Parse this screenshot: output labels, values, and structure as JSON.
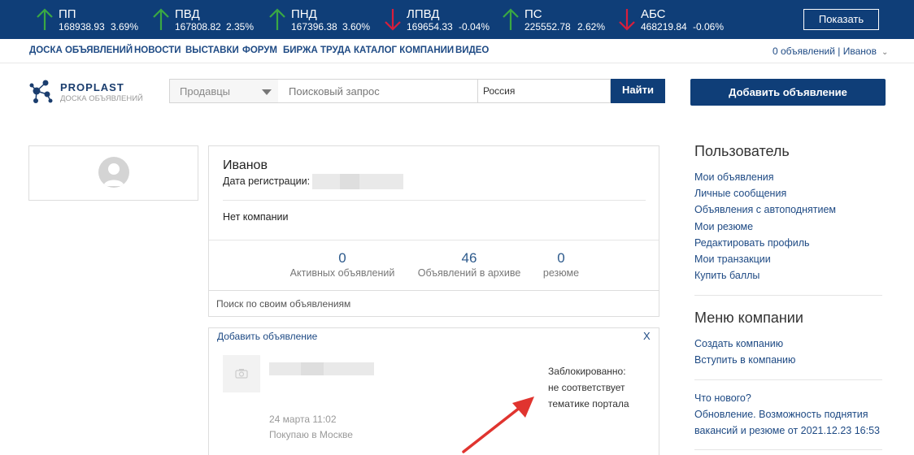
{
  "ticker": {
    "items": [
      {
        "name": "ПП",
        "price": "168938.93",
        "change": "3.69%",
        "direction": "up",
        "icon": "arrow-up-icon"
      },
      {
        "name": "ПВД",
        "price": "167808.82",
        "change": "2.35%",
        "direction": "up",
        "icon": "arrow-up-icon"
      },
      {
        "name": "ПНД",
        "price": "167396.38",
        "change": "3.60%",
        "direction": "up",
        "icon": "arrow-up-icon"
      },
      {
        "name": "ЛПВД",
        "price": "169654.33",
        "change": "-0.04%",
        "direction": "down",
        "icon": "arrow-down-icon"
      },
      {
        "name": "ПС",
        "price": "225552.78",
        "change": "2.62%",
        "direction": "up",
        "icon": "arrow-up-icon"
      },
      {
        "name": "АБС",
        "price": "468219.84",
        "change": "-0.06%",
        "direction": "down",
        "icon": "arrow-down-icon"
      }
    ],
    "show_button": "Показать",
    "colors": {
      "background": "#0f3e78",
      "up": "#3aa843",
      "down": "#d81e3c"
    }
  },
  "nav": {
    "links": [
      "ДОСКА ОБЪЯВЛЕНИЙ",
      "НОВОСТИ",
      "ВЫСТАВКИ",
      "ФОРУМ",
      "БИРЖА ТРУДА",
      "КАТАЛОГ КОМПАНИИ",
      "ВИДЕО"
    ],
    "account": "0 объявлений | Иванов"
  },
  "header": {
    "logo_title": "PROPLAST",
    "logo_subtitle": "ДОСКА ОБЪЯВЛЕНИЙ",
    "search": {
      "category": "Продавцы",
      "query_placeholder": "Поисковый запрос",
      "region": "Россия",
      "find_button": "Найти"
    },
    "add_ad_button": "Добавить объявление"
  },
  "profile": {
    "name": "Иванов",
    "reg_label": "Дата регистрации:",
    "company": "Нет компании",
    "stats": [
      {
        "value": "0",
        "label": "Активных объявлений"
      },
      {
        "value": "46",
        "label": "Объявлений в архиве"
      },
      {
        "value": "0",
        "label": "резюме"
      }
    ],
    "own_search_placeholder": "Поиск по своим объявлениям"
  },
  "ad": {
    "add_link": "Добавить объявление",
    "close": "X",
    "date": "24 марта 11:02",
    "location": "Покупаю в Москве",
    "status_lines": [
      "Заблокированно:",
      "не соответствует",
      "тематике портала"
    ]
  },
  "sidebar": {
    "user_title": "Пользователь",
    "user_links": [
      "Мои объявления",
      "Личные сообщения",
      "Объявления с автоподнятием",
      "Мои резюме",
      "Редактировать профиль",
      "Мои транзакции",
      "Купить баллы"
    ],
    "company_title": "Меню компании",
    "company_links": [
      "Создать компанию",
      "Вступить в компанию"
    ],
    "news_links": [
      "Что нового?",
      "Обновление. Возможность поднятия",
      "вакансий и резюме от 2021.12.23 16:53"
    ]
  }
}
